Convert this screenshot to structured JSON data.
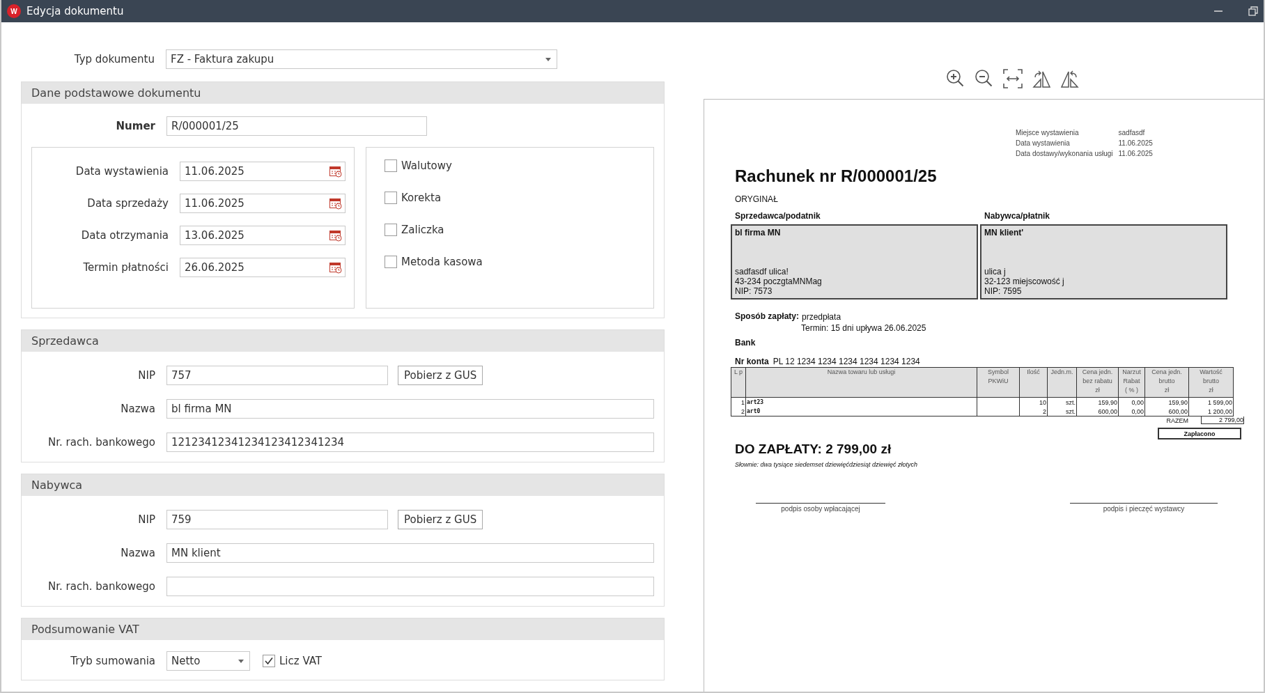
{
  "window": {
    "title": "Edycja dokumentu",
    "icon_letter": "W"
  },
  "document_type": {
    "label": "Typ dokumentu",
    "value": "FZ - Faktura zakupu"
  },
  "basic_section": {
    "title": "Dane podstawowe dokumentu",
    "number": {
      "label": "Numer",
      "value": "R/000001/25"
    },
    "dates": [
      {
        "label": "Data wystawienia",
        "value": "11.06.2025"
      },
      {
        "label": "Data sprzedaży",
        "value": "11.06.2025"
      },
      {
        "label": "Data otrzymania",
        "value": "13.06.2025"
      },
      {
        "label": "Termin płatności",
        "value": "26.06.2025"
      }
    ],
    "options": [
      {
        "label": "Walutowy",
        "checked": false
      },
      {
        "label": "Korekta",
        "checked": false
      },
      {
        "label": "Zaliczka",
        "checked": false
      },
      {
        "label": "Metoda kasowa",
        "checked": false
      }
    ]
  },
  "parties": [
    {
      "title": "Sprzedawca",
      "fields": [
        {
          "kind": "nip",
          "label": "NIP",
          "value": "757",
          "button": "Pobierz z GUS"
        },
        {
          "kind": "text",
          "label": "Nazwa",
          "value": "bl firma MN"
        },
        {
          "kind": "text",
          "label": "Nr. rach. bankowego",
          "value": "12123412341234123412341234"
        }
      ]
    },
    {
      "title": "Nabywca",
      "fields": [
        {
          "kind": "nip",
          "label": "NIP",
          "value": "759",
          "button": "Pobierz z GUS"
        },
        {
          "kind": "text",
          "label": "Nazwa",
          "value": "MN klient"
        },
        {
          "kind": "text",
          "label": "Nr. rach. bankowego"
        }
      ]
    }
  ],
  "vat_summary": {
    "title": "Podsumowanie VAT",
    "mode": {
      "label": "Tryb sumowania",
      "value": "Netto"
    },
    "count_vat": {
      "label": "Licz VAT",
      "checked": true
    }
  },
  "preview": {
    "meta": [
      {
        "label": "Miejsce wystawienia",
        "value": "sadfasdf"
      },
      {
        "label": "Data wystawienia",
        "value": "11.06.2025"
      },
      {
        "label": "Data dostawy/wykonania usługi",
        "value": "11.06.2025"
      }
    ],
    "title": "Rachunek nr R/000001/25",
    "copy": "ORYGINAŁ",
    "parties": [
      {
        "heading": "Sprzedawca/podatnik",
        "name": "bl firma MN",
        "lines": [
          "sadfasdf ulica!",
          "43-234 poczgtaMNMag",
          "NIP: 7573"
        ]
      },
      {
        "heading": "Nabywca/płatnik",
        "name": "MN klient'",
        "lines": [
          "ulica j",
          "32-123 miejscowość j",
          "NIP: 7595"
        ]
      }
    ],
    "payment": {
      "label": "Sposób zapłaty:",
      "method": "przedpłata",
      "term": "Termin: 15 dni upływa 26.06.2025"
    },
    "bank": "Bank",
    "account": {
      "label": "Nr konta",
      "value": "PL 12 1234 1234 1234 1234 1234 1234"
    },
    "table": {
      "columns": [
        [
          "L p"
        ],
        [
          "Nazwa towaru lub usługi"
        ],
        [
          "Symbol",
          "PKWiU"
        ],
        [
          "Ilość"
        ],
        [
          "Jedn.m."
        ],
        [
          "Cena jedn.",
          "bez rabatu",
          "zł"
        ],
        [
          "Narzut",
          "Rabat",
          "( % )"
        ],
        [
          "Cena jedn.",
          "brutto",
          "zł"
        ],
        [
          "Wartość",
          "brutto",
          "zł"
        ]
      ],
      "rows": [
        {
          "lp": "1",
          "name": "art23",
          "qty": "10",
          "unit": "szt.",
          "price": "159,90",
          "rate": "0,00",
          "gross_price": "159,90",
          "value": "1 599,00"
        },
        {
          "lp": "2",
          "name": "art0",
          "qty": "2",
          "unit": "szt.",
          "price": "600,00",
          "rate": "0,00",
          "gross_price": "600,00",
          "value": "1 200,00"
        }
      ],
      "total_label": "RAZEM",
      "total": "2 799,00"
    },
    "stamp": "Zapłacono",
    "due": "DO ZAPŁATY: 2 799,00 zł",
    "in_words": "Słownie: dwa tysiące siedemset dziewięćdziesiąt dziewięć złotych",
    "signatures": [
      "podpis osoby wpłacającej",
      "podpis i pieczęć wystawcy"
    ]
  }
}
